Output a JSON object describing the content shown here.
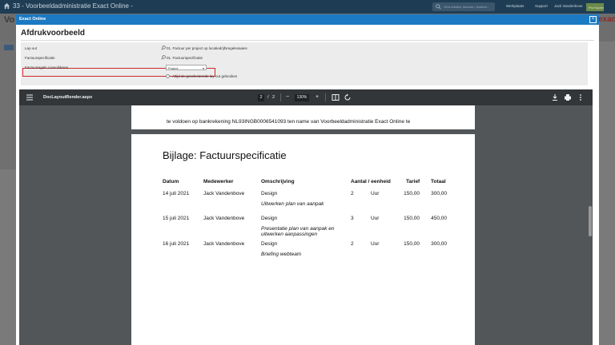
{
  "app": {
    "title": "33 - Voorbeeldadministratie Exact Online -",
    "search_placeholder": "Vind relaties, facturen, boeken...",
    "menu": [
      "Werkplaats",
      "Support",
      "Jack Vandenbove"
    ],
    "badge": "Pro Kopen",
    "header_letter": "Vo",
    "logo": "exact"
  },
  "modal": {
    "bar_title": "Exact Online",
    "close_label": "×",
    "title": "Afdrukvoorbeeld",
    "form": {
      "layout_label": "Lay-out",
      "layout_value": "01. Factuur per project op locatiedrijfsregelesaaies",
      "spec_label": "Factuurspecificatie",
      "spec_value": "01. Factuurspecificatie",
      "consolidate_label": "Factuurregels consolideren",
      "consolidate_value": "Project",
      "radio_label": "Altijd de geselecteerde lay-out gebruiken"
    }
  },
  "viewer": {
    "filename": "DocLayoutRender.aspx",
    "page_current": "2",
    "page_sep": "/",
    "page_total": "2",
    "zoom": "130%",
    "minus": "−",
    "plus": "+"
  },
  "document": {
    "page1_line": "te voldoen op bankrekening NL93INGB0006541093 ten name van Voorbeeldadministratie Exact Online te",
    "heading": "Bijlage: Factuurspecificatie",
    "columns": [
      "Datum",
      "Medewerker",
      "Omschrijving",
      "Aantal / eenheid",
      "Tarief",
      "Totaal"
    ],
    "rows": [
      {
        "date": "14 juli 2021",
        "employee": "Jack Vandenbove",
        "desc": "Design",
        "qty": "2",
        "unit": "Uur",
        "rate": "150,00",
        "total": "300,00",
        "note": "Uitwerken plan van aanpak",
        "note2": ""
      },
      {
        "date": "15 juli 2021",
        "employee": "Jack Vandenbove",
        "desc": "Design",
        "qty": "3",
        "unit": "Uur",
        "rate": "150,00",
        "total": "450,00",
        "note": "Presentatie plan van aanpak en",
        "note2": "uitwerken aanpassingen"
      },
      {
        "date": "16 juli 2021",
        "employee": "Jack Vandenbove",
        "desc": "Design",
        "qty": "2",
        "unit": "Uur",
        "rate": "150,00",
        "total": "300,00",
        "note": "Briefing webteam",
        "note2": ""
      }
    ]
  },
  "colors": {
    "modal_bar": "#1b7ac3",
    "highlight": "#cc2a2a",
    "viewer_toolbar": "#323639",
    "viewer_bg": "#525659"
  }
}
